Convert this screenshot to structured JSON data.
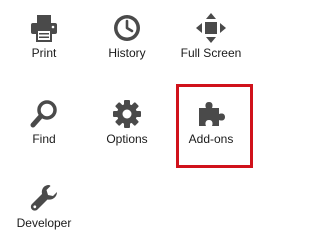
{
  "menu": {
    "items": [
      {
        "label": "Print",
        "icon": "printer-icon"
      },
      {
        "label": "History",
        "icon": "clock-icon"
      },
      {
        "label": "Full Screen",
        "icon": "expand-arrows-icon"
      },
      {
        "label": "Find",
        "icon": "magnifier-icon"
      },
      {
        "label": "Options",
        "icon": "gear-icon"
      },
      {
        "label": "Add-ons",
        "icon": "puzzle-piece-icon"
      },
      {
        "label": "Developer",
        "icon": "wrench-icon"
      }
    ],
    "highlighted_item": "Add-ons"
  },
  "colors": {
    "icon": "#4a4a4a",
    "text": "#1a1a1a",
    "highlight": "#d0121b",
    "background": "#ffffff"
  }
}
